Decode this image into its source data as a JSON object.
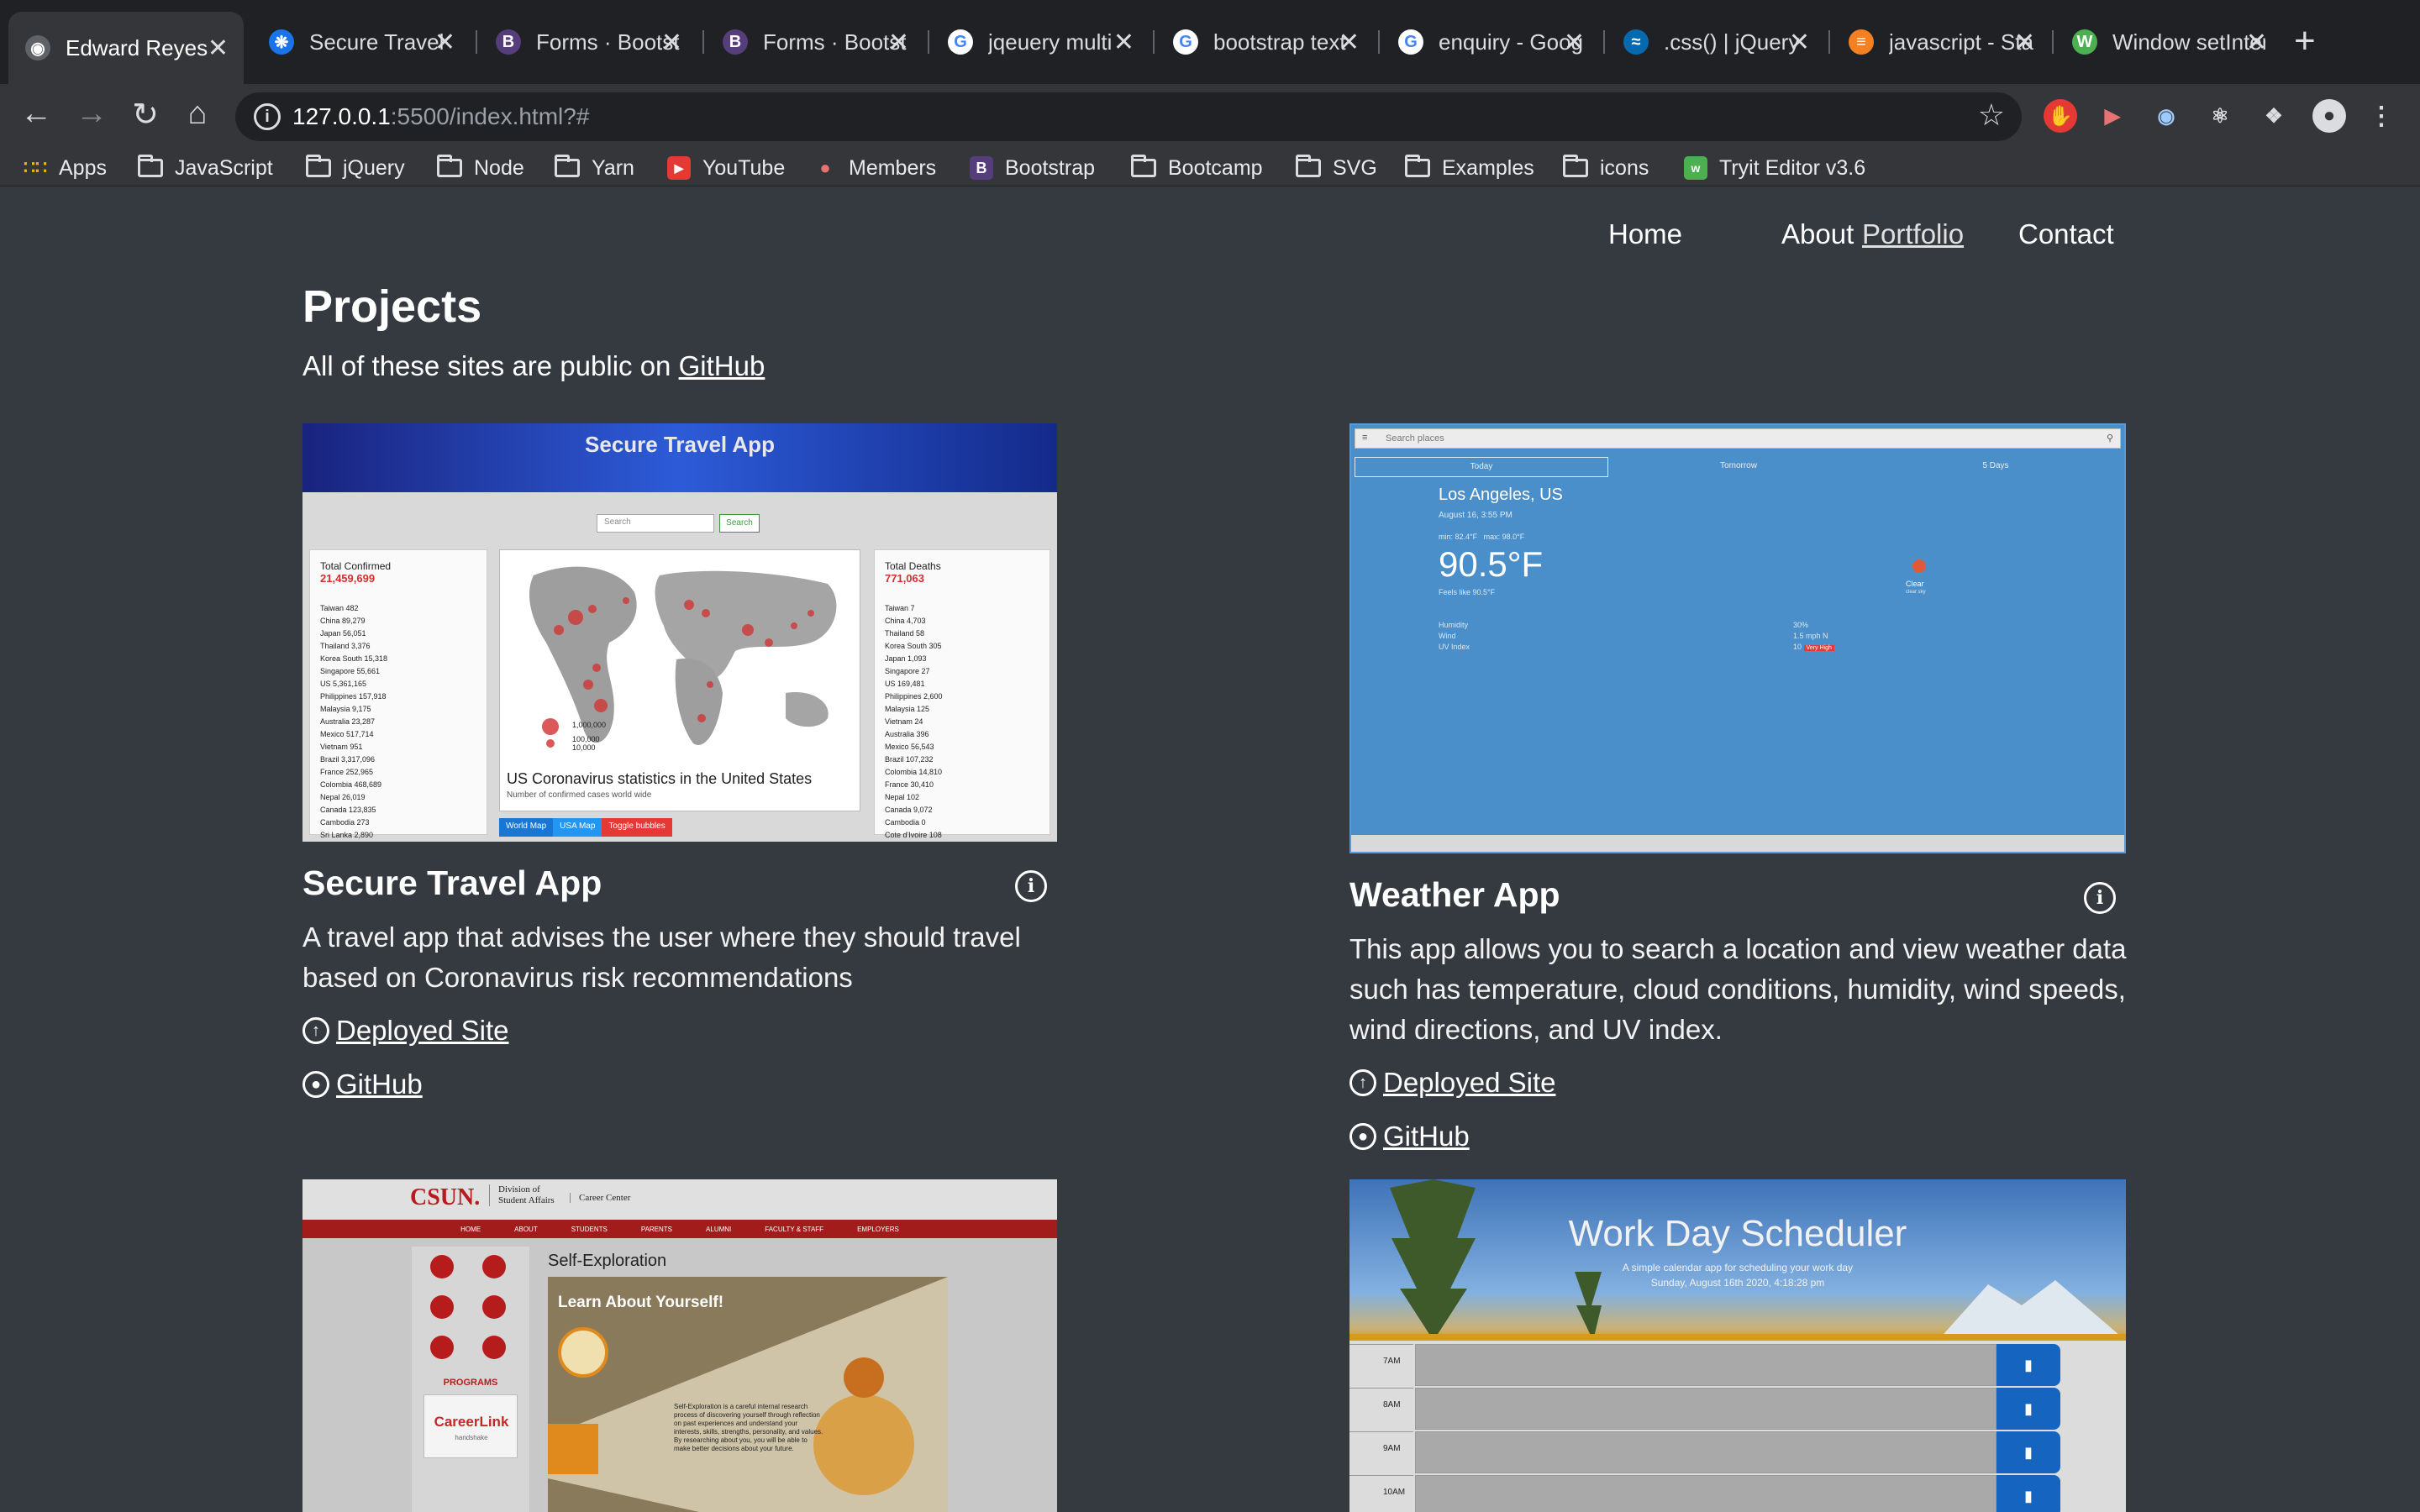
{
  "browser": {
    "tabs": [
      {
        "title": "Edward Reyes",
        "active": true,
        "favicon": "globe-icon"
      },
      {
        "title": "Secure Travel",
        "favicon": "gear-icon"
      },
      {
        "title": "Forms · Bootstrap",
        "favicon": "bootstrap-icon"
      },
      {
        "title": "Forms · Bootstrap",
        "favicon": "bootstrap-icon"
      },
      {
        "title": "jqeuery multi",
        "favicon": "google-icon"
      },
      {
        "title": "bootstrap text",
        "favicon": "google-icon"
      },
      {
        "title": "enquiry - Google",
        "favicon": "google-icon"
      },
      {
        "title": ".css() | jQuery",
        "favicon": "jquery-icon"
      },
      {
        "title": "javascript - Stack",
        "favicon": "stackoverflow-icon"
      },
      {
        "title": "Window setInterval",
        "favicon": "w3schools-icon"
      }
    ],
    "url_host": "127.0.0.1",
    "url_rest": ":5500/index.html?#",
    "bookmarks": [
      "Apps",
      "JavaScript",
      "jQuery",
      "Node",
      "Yarn",
      "YouTube",
      "Members",
      "Bootstrap",
      "Bootcamp",
      "SVG",
      "Examples",
      "icons",
      "Tryit Editor v3.6"
    ]
  },
  "nav": {
    "home": "Home",
    "about": "About",
    "portfolio": "Portfolio",
    "contact": "Contact"
  },
  "page": {
    "title": "Projects",
    "subtitle": "All of these sites are public on",
    "subtitle_link": "GitHub"
  },
  "projects": [
    {
      "title": "Secure Travel App",
      "description_1": "A travel app that advises the user where they should travel",
      "description_2": "based on Coronavirus risk recommendations",
      "deployed": "Deployed Site",
      "github": "GitHub",
      "screenshot": {
        "header": "Secure Travel App",
        "search_placeholder": "Search",
        "search_button": "Search",
        "confirmed_label": "Total Confirmed",
        "confirmed_value": "21,459,699",
        "deaths_label": "Total Deaths",
        "deaths_value": "771,063",
        "confirmed_list": [
          "Taiwan 482",
          "China 89,279",
          "Japan 56,051",
          "Thailand 3,376",
          "Korea South 15,318",
          "Singapore 55,661",
          "US 5,361,165",
          "Philippines 157,918",
          "Malaysia 9,175",
          "Australia 23,287",
          "Mexico 517,714",
          "Vietnam 951",
          "Brazil 3,317,096",
          "France 252,965",
          "Colombia 468,689",
          "Nepal 26,019",
          "Canada 123,835",
          "Cambodia 273",
          "Sri Lanka 2,890"
        ],
        "deaths_list": [
          "Taiwan 7",
          "China 4,703",
          "Thailand 58",
          "Korea South 305",
          "Japan 1,093",
          "Singapore 27",
          "US 169,481",
          "Philippines 2,600",
          "Malaysia 125",
          "Vietnam 24",
          "Australia 396",
          "Mexico 56,543",
          "Brazil 107,232",
          "Colombia 14,810",
          "France 30,410",
          "Nepal 102",
          "Canada 9,072",
          "Cambodia 0",
          "Cote d'Ivoire 108"
        ],
        "map_title": "US Coronavirus statistics in the United States",
        "map_subtitle": "Number of confirmed cases world wide",
        "legend_1": "1,000,000",
        "legend_2": "100,000",
        "legend_3": "10,000",
        "btn_world": "World Map",
        "btn_usa": "USA Map",
        "btn_bubbles": "Toggle bubbles"
      }
    },
    {
      "title": "Weather App",
      "description_1": "This app allows you to search a location and view weather data",
      "description_2": "such has temperature, cloud conditions, humidity, wind speeds,",
      "description_3": "wind directions, and UV index.",
      "deployed": "Deployed Site",
      "github": "GitHub",
      "screenshot": {
        "search_placeholder": "Search places",
        "tab_today": "Today",
        "tab_tomorrow": "Tomorrow",
        "tab_5days": "5 Days",
        "city": "Los Angeles, US",
        "date": "August 16, 3:55 PM",
        "minmax": "min: 82.4°F   max: 98.0°F",
        "temp": "90.5°F",
        "feels": "Feels like 90.5°F",
        "condition": "Clear",
        "condition_sub": "clear sky",
        "humidity_label": "Humidity",
        "humidity_value": "30%",
        "wind_label": "Wind",
        "wind_value": "1.5 mph N",
        "uv_label": "UV Index",
        "uv_value": "10",
        "uv_badge": "Very High"
      }
    },
    {
      "screenshot": {
        "logo": "CSUN.",
        "division": "Division of Student Affairs",
        "center": "Career Center",
        "menu": [
          "HOME",
          "ABOUT",
          "STUDENTS",
          "PARENTS",
          "ALUMNI",
          "FACULTY & STAFF",
          "EMPLOYERS"
        ],
        "heading": "Self-Exploration",
        "banner": "Learn About Yourself!",
        "programs": "PROGRAMS",
        "careerlink": "CareerLink",
        "handshake": "handshake",
        "body": "Self-Exploration is a careful internal research process of discovering yourself through reflection on past experiences and understand your interests, skills, strengths, personality, and values. By researching about you, you will be able to make better decisions about your future."
      }
    },
    {
      "screenshot": {
        "title": "Work Day Scheduler",
        "subtitle": "A simple calendar app for scheduling your work day",
        "date": "Sunday, August 16th 2020, 4:18:28 pm",
        "hours": [
          "7AM",
          "8AM",
          "9AM",
          "10AM"
        ]
      }
    }
  ],
  "colors": {
    "page_bg": "#343a40",
    "chrome_bg": "#202124",
    "toolbar_bg": "#35363a",
    "uv_badge": "#e53935",
    "save_btn": "#1565c0"
  }
}
